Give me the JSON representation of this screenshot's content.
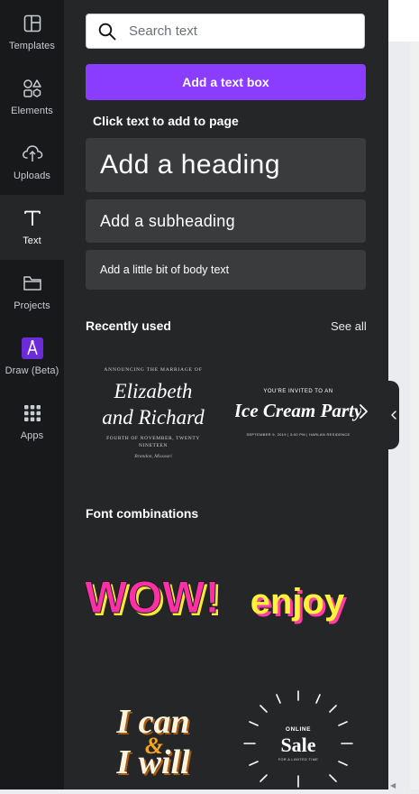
{
  "rail": {
    "items": [
      {
        "label": "Templates",
        "icon": "templates-icon"
      },
      {
        "label": "Elements",
        "icon": "elements-icon"
      },
      {
        "label": "Uploads",
        "icon": "uploads-icon"
      },
      {
        "label": "Text",
        "icon": "text-icon",
        "active": true
      },
      {
        "label": "Projects",
        "icon": "projects-icon"
      },
      {
        "label": "Draw (Beta)",
        "icon": "draw-icon"
      },
      {
        "label": "Apps",
        "icon": "apps-icon"
      }
    ]
  },
  "panel": {
    "search_placeholder": "Search text",
    "add_text_box": "Add a text box",
    "click_hint": "Click text to add to page",
    "heading": "Add a heading",
    "subheading": "Add a subheading",
    "body_text": "Add a little bit of body text",
    "recently_used": {
      "title": "Recently used",
      "see_all": "See all",
      "cards": [
        {
          "kicker": "ANNOUNCING THE MARRIAGE OF",
          "line1": "Elizabeth",
          "line2": "and Richard",
          "date": "FOURTH OF NOVEMBER, TWENTY",
          "date2": "NINETEEN",
          "place": "Brandon, Missouri"
        },
        {
          "kicker": "YOU'RE INVITED TO AN",
          "title": "Ice Cream Party",
          "details": "SEPTEMBER 9, 2019 | 3:00 PM | HARLAN RESIDENCE"
        }
      ]
    },
    "font_combinations": {
      "title": "Font combinations",
      "cards": [
        {
          "text": "WOW!"
        },
        {
          "text": "enjoy"
        },
        {
          "line1": "I can",
          "line2": "&",
          "line3": "I will"
        },
        {
          "kicker": "ONLINE",
          "title": "Sale",
          "sub": "FOR A LIMITED TIME"
        }
      ]
    }
  },
  "colors": {
    "rail_bg": "#18191b",
    "panel_bg": "#252627",
    "accent": "#8b3dff",
    "block_bg": "#3a3b3d",
    "wow_pink": "#ff2fa8",
    "wow_yellow": "#f5e93a",
    "enjoy_yellow": "#fff23a",
    "enjoy_pink": "#ff3da6",
    "ican_orange": "#f5a623"
  }
}
